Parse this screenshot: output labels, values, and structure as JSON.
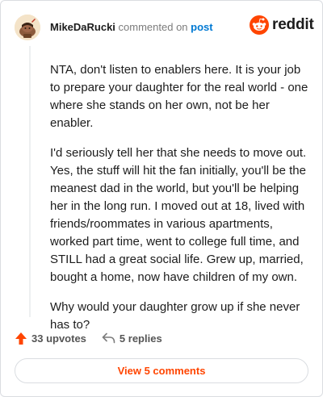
{
  "header": {
    "username": "MikeDaRucki",
    "commented_on": "commented on",
    "post_link": "post"
  },
  "logo": {
    "text": "reddit",
    "icon": "reddit-snoo-icon",
    "color": "#ff4500"
  },
  "comment": {
    "paragraphs": [
      "NTA, don't listen to enablers here. It is your job to prepare your daughter for the real world - one where she stands on her own, not be her enabler.",
      "I'd seriously tell her that she needs to move out. Yes, the stuff will hit the fan initially, you'll be the meanest dad in the world, but you'll be helping her in the long run. I moved out at 18, lived with friends/roommates in various apartments, worked part time, went to college full time, and STILL had a great social life. Grew up, married, bought a home, now have children of my own.",
      "Why would your daughter grow up if she never has to?"
    ]
  },
  "actions": {
    "upvotes": "33 upvotes",
    "upvote_icon": "upvote-arrow-icon",
    "replies": "5 replies",
    "reply_icon": "reply-arrow-icon"
  },
  "view_comments": {
    "label": "View 5 comments"
  },
  "colors": {
    "accent": "#ff4500",
    "link": "#0079d3",
    "border": "#dadde1"
  }
}
